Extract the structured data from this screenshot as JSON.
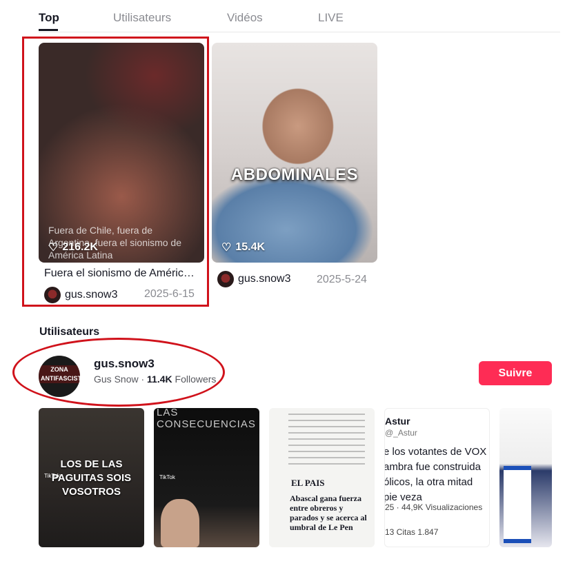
{
  "tabs": [
    {
      "label": "Top",
      "active": true
    },
    {
      "label": "Utilisateurs",
      "active": false
    },
    {
      "label": "Vidéos",
      "active": false
    },
    {
      "label": "LIVE",
      "active": false
    }
  ],
  "videos": [
    {
      "likes": "216.2K",
      "overlay": "Fuera de Chile, fuera de Argentina, fuera el sionismo de América Latina",
      "caption": "Fuera el sionismo de Améric…",
      "author": "gus.snow3",
      "date": "2025-6-15"
    },
    {
      "likes": "15.4K",
      "overlay_title": "ABDOMINALES",
      "caption": "",
      "author": "gus.snow3",
      "date": "2025-5-24"
    }
  ],
  "users_section": {
    "title": "Utilisateurs",
    "user": {
      "username": "gus.snow3",
      "display_name": "Gus Snow",
      "separator": "·",
      "followers_count": "11.4K",
      "followers_label": "Followers",
      "avatar_text": "ZONA ANTIFASCISTA",
      "follow_label": "Suivre"
    }
  },
  "strip": [
    {
      "text": "LOS DE LAS PAGUITAS SOIS VOSOTROS",
      "badge": "TikTok"
    },
    {
      "text": "LAS CONSECUENCIAS",
      "badge": "TikTok"
    },
    {
      "text": "EL PAIS",
      "headline": "Abascal gana fuerza entre obreros y parados y se acerca al umbral de Le Pen"
    },
    {
      "text": "Astur",
      "handle": "@_Astur",
      "body": "e los votantes de VOX ambra fue construida ólicos, la otra mitad pie veza",
      "stats": "25 · 44,9K Visualizaciones",
      "stats2": "13 Citas 1.847"
    },
    {
      "text": ""
    }
  ],
  "colors": {
    "accent": "#fe2c55",
    "annotation": "#d0121b"
  }
}
